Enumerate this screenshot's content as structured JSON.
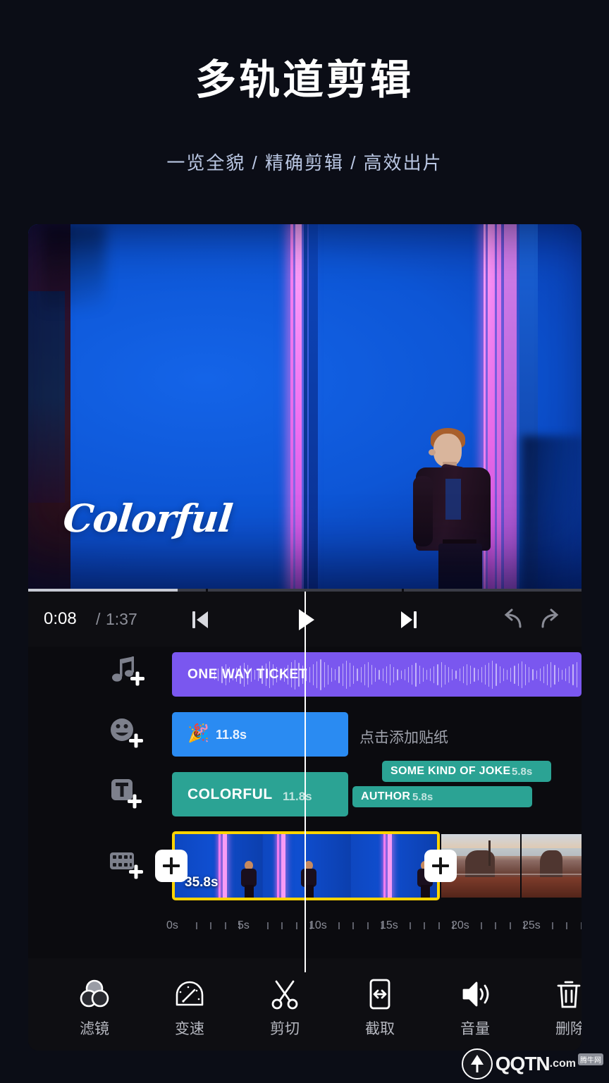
{
  "header": {
    "title": "多轨道剪辑",
    "subtitle": "一览全貌 / 精确剪辑 / 高效出片"
  },
  "preview": {
    "overlay_text": "Colorful",
    "progress_percent": 27
  },
  "transport": {
    "current_time": "0:08",
    "separator": "/",
    "total_time": "1:37",
    "prev_label": "skip-previous-icon",
    "play_label": "play-icon",
    "next_label": "skip-next-icon",
    "undo_label": "undo-icon",
    "redo_label": "redo-icon"
  },
  "timeline": {
    "lane_icons": {
      "audio": "music-note-add-icon",
      "sticker": "smiley-add-icon",
      "text": "text-add-icon",
      "video": "film-strip-add-icon"
    },
    "audio_track": {
      "title": "ONE WAY TICKET"
    },
    "sticker_track": {
      "emoji": "🎉",
      "duration": "11.8s",
      "hint": "点击添加贴纸"
    },
    "text_track": {
      "main_label": "COLORFUL",
      "main_duration": "11.8s",
      "clip_a_label": "SOME KIND OF JOKE",
      "clip_a_duration": "5.8s",
      "clip_b_label": "AUTHOR",
      "clip_b_duration": "5.8s"
    },
    "video_track": {
      "duration": "35.8s",
      "add_left_label": "+",
      "add_right_label": "+"
    },
    "ruler": {
      "labels": [
        "0s",
        "5s",
        "10s",
        "15s",
        "20s",
        "25s"
      ]
    }
  },
  "toolbar": {
    "items": [
      {
        "label": "滤镜",
        "icon": "filter-icon"
      },
      {
        "label": "变速",
        "icon": "speed-icon"
      },
      {
        "label": "剪切",
        "icon": "scissors-icon"
      },
      {
        "label": "截取",
        "icon": "trim-icon"
      },
      {
        "label": "音量",
        "icon": "volume-icon"
      },
      {
        "label": "删除",
        "icon": "trash-icon"
      }
    ]
  },
  "watermark": {
    "name": "QQTN",
    "tld": ".com",
    "badge": "腾牛网"
  },
  "colors": {
    "background": "#0b0d16",
    "panel": "#0e0e12",
    "audio_clip": "#7a57ef",
    "sticker_clip": "#2a8bf2",
    "text_clip": "#2ba394",
    "selection": "#ffd400",
    "subtitle": "#b9c6e2"
  }
}
